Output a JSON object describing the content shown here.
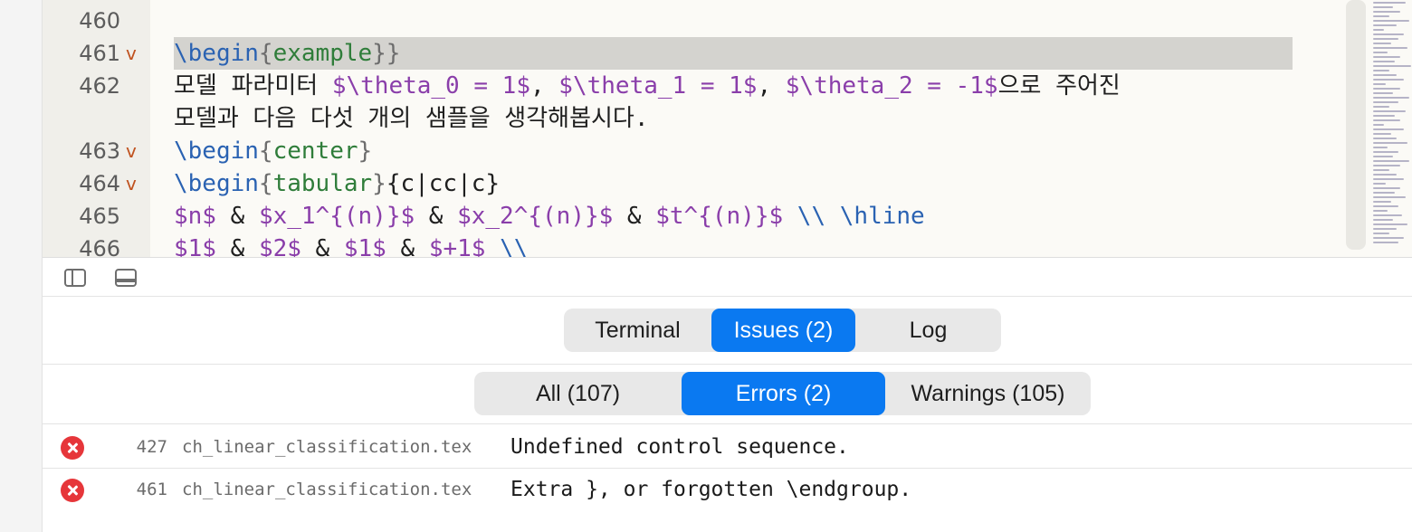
{
  "editor": {
    "lines": [
      {
        "num": "460",
        "fold": "",
        "parts": []
      },
      {
        "num": "461",
        "fold": "v",
        "parts": [
          {
            "t": "\\begin",
            "c": "kw"
          },
          {
            "t": "{",
            "c": "brace"
          },
          {
            "t": "example",
            "c": "arg"
          },
          {
            "t": "}}",
            "c": "brace"
          }
        ]
      },
      {
        "num": "462",
        "fold": "",
        "parts": [
          {
            "t": "모델 파라미터 ",
            "c": ""
          },
          {
            "t": "$\\theta_0 = 1$",
            "c": "math"
          },
          {
            "t": ", ",
            "c": ""
          },
          {
            "t": "$\\theta_1 = 1$",
            "c": "math"
          },
          {
            "t": ", ",
            "c": ""
          },
          {
            "t": "$\\theta_2 = -1$",
            "c": "math"
          },
          {
            "t": "으로 주어진",
            "c": ""
          }
        ]
      },
      {
        "num": "",
        "fold": "",
        "parts": [
          {
            "t": "모델과 다음 다섯 개의 샘플을 생각해봅시다.",
            "c": ""
          }
        ]
      },
      {
        "num": "463",
        "fold": "v",
        "parts": [
          {
            "t": "\\begin",
            "c": "kw"
          },
          {
            "t": "{",
            "c": "brace"
          },
          {
            "t": "center",
            "c": "arg"
          },
          {
            "t": "}",
            "c": "brace"
          }
        ]
      },
      {
        "num": "464",
        "fold": "v",
        "parts": [
          {
            "t": "\\begin",
            "c": "kw"
          },
          {
            "t": "{",
            "c": "brace"
          },
          {
            "t": "tabular",
            "c": "arg"
          },
          {
            "t": "}",
            "c": "brace"
          },
          {
            "t": "{c|cc|c}",
            "c": ""
          }
        ]
      },
      {
        "num": "465",
        "fold": "",
        "parts": [
          {
            "t": "$n$",
            "c": "math"
          },
          {
            "t": " & ",
            "c": ""
          },
          {
            "t": "$x_1^{(n)}$",
            "c": "math"
          },
          {
            "t": " & ",
            "c": ""
          },
          {
            "t": "$x_2^{(n)}$",
            "c": "math"
          },
          {
            "t": " & ",
            "c": ""
          },
          {
            "t": "$t^{(n)}$",
            "c": "math"
          },
          {
            "t": " ",
            "c": ""
          },
          {
            "t": "\\\\ \\hline",
            "c": "kw"
          }
        ]
      },
      {
        "num": "466",
        "fold": "",
        "parts": [
          {
            "t": "$1$",
            "c": "math"
          },
          {
            "t": " & ",
            "c": ""
          },
          {
            "t": "$2$",
            "c": "math"
          },
          {
            "t": " & ",
            "c": ""
          },
          {
            "t": "$1$",
            "c": "math"
          },
          {
            "t": " & ",
            "c": ""
          },
          {
            "t": "$+1$",
            "c": "math"
          },
          {
            "t": " ",
            "c": ""
          },
          {
            "t": "\\\\",
            "c": "kw"
          }
        ]
      }
    ]
  },
  "panel": {
    "tabs": [
      "Terminal",
      "Issues (2)",
      "Log"
    ],
    "active_tab": 1,
    "filters": [
      "All (107)",
      "Errors (2)",
      "Warnings (105)"
    ],
    "active_filter": 1
  },
  "issues": [
    {
      "icon": "error-icon",
      "line": "427",
      "file": "ch_linear_classification.tex",
      "message": "Undefined control sequence."
    },
    {
      "icon": "error-icon",
      "line": "461",
      "file": "ch_linear_classification.tex",
      "message": "Extra }, or forgotten \\endgroup."
    }
  ],
  "colors": {
    "accent": "#0a79f1",
    "error": "#e6363a",
    "keyword": "#2a62b2",
    "argument": "#2f7d3a",
    "math": "#8a3eaa",
    "fold_marker": "#c0521f"
  }
}
